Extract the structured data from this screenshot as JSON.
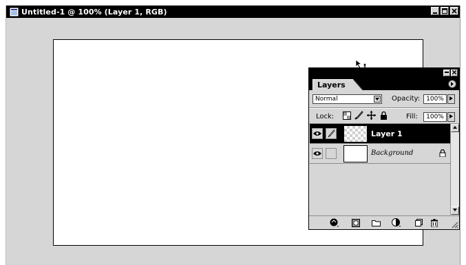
{
  "document": {
    "title": "Untitled-1 @ 100% (Layer 1, RGB)",
    "window_buttons": [
      "minimize",
      "maximize",
      "close"
    ]
  },
  "layers_panel": {
    "tab_label": "Layers",
    "blend_mode": "Normal",
    "opacity_label": "Opacity:",
    "opacity_value": "100%",
    "lock_label": "Lock:",
    "fill_label": "Fill:",
    "fill_value": "100%",
    "layers": [
      {
        "name": "Layer 1",
        "selected": true,
        "visible": true,
        "locked": false
      },
      {
        "name": "Background",
        "selected": false,
        "visible": true,
        "locked": true
      }
    ],
    "lock_icons": [
      "lock-transparency-icon",
      "lock-image-icon",
      "lock-position-icon",
      "lock-all-icon"
    ],
    "bottom_icons": [
      "add-layer-style-icon",
      "add-mask-icon",
      "new-set-icon",
      "new-fill-adjustment-icon",
      "new-layer-icon",
      "trash-icon"
    ]
  },
  "colors": {
    "window_bg": "#d6d6d6",
    "titlebar": "#000000",
    "selected_row": "#000000"
  }
}
